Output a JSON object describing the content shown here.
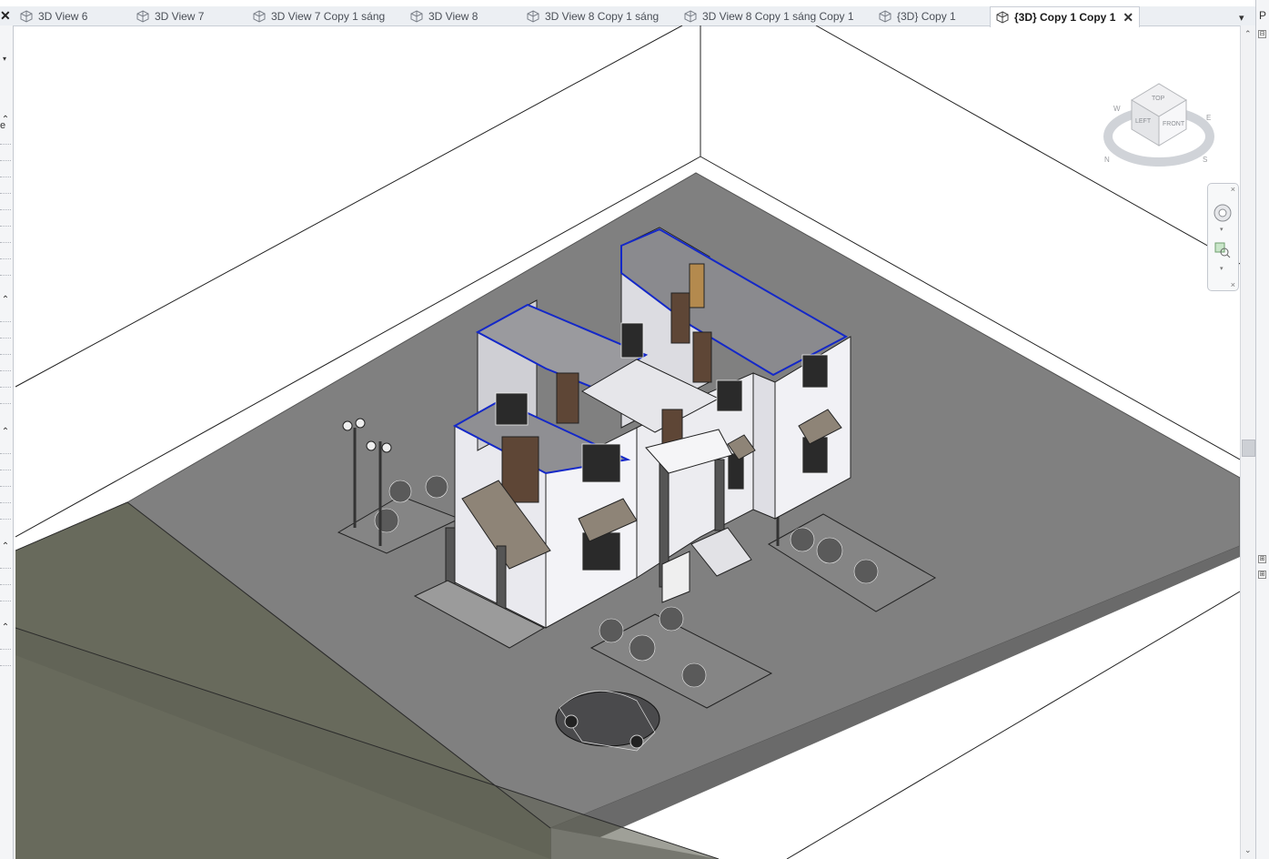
{
  "tabs": [
    {
      "label": "3D View 6",
      "active": false
    },
    {
      "label": "3D View 7",
      "active": false
    },
    {
      "label": "3D View 7 Copy 1 sáng",
      "active": false
    },
    {
      "label": "3D View 8",
      "active": false
    },
    {
      "label": "3D View 8 Copy 1 sáng",
      "active": false
    },
    {
      "label": "3D View 8 Copy 1 sáng Copy 1",
      "active": false
    },
    {
      "label": "{3D} Copy 1",
      "active": false
    },
    {
      "label": "{3D} Copy 1 Copy 1",
      "active": true
    }
  ],
  "tab_close_glyph": "✕",
  "left_close_glyph": "✕",
  "tab_menu_glyph": "▾",
  "left_panel": {
    "label_fragment": "e",
    "dropdown_glyph": "▾",
    "collapse_glyph": "⌃"
  },
  "right_panel": {
    "title_fragment": "P",
    "collapse_glyph": "⊟",
    "expand_glyph": "⊞"
  },
  "viewcube": {
    "faces": [
      "TOP",
      "LEFT",
      "FRONT"
    ],
    "compass": [
      "N",
      "W",
      "S",
      "E"
    ]
  },
  "navbar": {
    "close_glyph": "×",
    "dropdown_glyph": "▾"
  },
  "scrollbar": {
    "up_glyph": "⌃",
    "down_glyph": "⌄"
  },
  "colors": {
    "ground": "#7f7f7f",
    "road": "#6b6c5e",
    "wall": "#f2f2f2",
    "highlight": "#1428c8",
    "roof": "#8e8477"
  },
  "icons": [
    "3d-view-icon",
    "close-icon",
    "steering-wheel-icon",
    "zoom-icon"
  ]
}
